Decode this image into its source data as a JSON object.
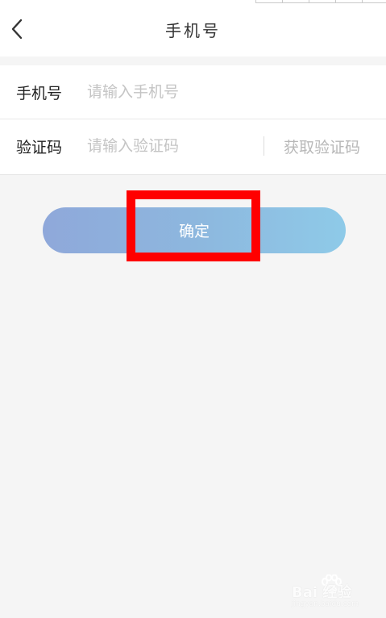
{
  "header": {
    "title": "手机号"
  },
  "form": {
    "phone": {
      "label": "手机号",
      "placeholder": "请输入手机号",
      "value": ""
    },
    "code": {
      "label": "验证码",
      "placeholder": "请输入验证码",
      "value": "",
      "get_code_label": "获取验证码"
    }
  },
  "actions": {
    "confirm_label": "确定"
  },
  "annotation": {
    "highlight_color": "#ff0000"
  },
  "watermark": {
    "text": "Bai 经验",
    "url": "jingyan.baidu.com"
  },
  "colors": {
    "button_gradient_start": "#8fa8da",
    "button_gradient_end": "#8ecae8",
    "background": "#f5f5f5"
  },
  "icons": {
    "back": "chevron-left-icon",
    "watermark_logo": "baidu-paw-icon"
  }
}
